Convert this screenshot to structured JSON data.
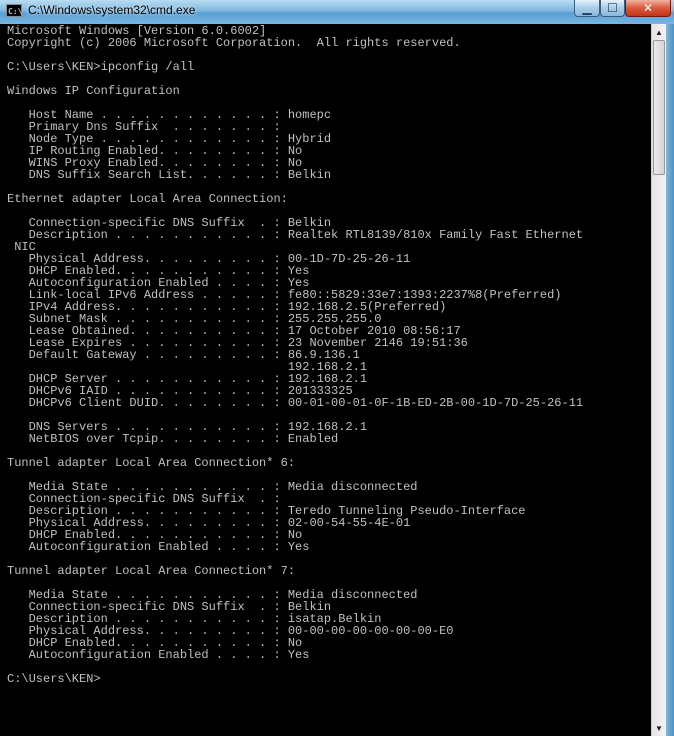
{
  "window": {
    "title": "C:\\Windows\\system32\\cmd.exe",
    "icon": "cmd-icon",
    "icon_text": "C:\\"
  },
  "controls": {
    "minimize": "▁",
    "maximize": "☐",
    "close": "✕"
  },
  "scrollbar": {
    "up": "▲",
    "down": "▼"
  },
  "console": {
    "lines": [
      "Microsoft Windows [Version 6.0.6002]",
      "Copyright (c) 2006 Microsoft Corporation.  All rights reserved.",
      "",
      "C:\\Users\\KEN>ipconfig /all",
      "",
      "Windows IP Configuration",
      "",
      "   Host Name . . . . . . . . . . . . : homepc",
      "   Primary Dns Suffix  . . . . . . . :",
      "   Node Type . . . . . . . . . . . . : Hybrid",
      "   IP Routing Enabled. . . . . . . . : No",
      "   WINS Proxy Enabled. . . . . . . . : No",
      "   DNS Suffix Search List. . . . . . : Belkin",
      "",
      "Ethernet adapter Local Area Connection:",
      "",
      "   Connection-specific DNS Suffix  . : Belkin",
      "   Description . . . . . . . . . . . : Realtek RTL8139/810x Family Fast Ethernet",
      " NIC",
      "   Physical Address. . . . . . . . . : 00-1D-7D-25-26-11",
      "   DHCP Enabled. . . . . . . . . . . : Yes",
      "   Autoconfiguration Enabled . . . . : Yes",
      "   Link-local IPv6 Address . . . . . : fe80::5829:33e7:1393:2237%8(Preferred)",
      "   IPv4 Address. . . . . . . . . . . : 192.168.2.5(Preferred)",
      "   Subnet Mask . . . . . . . . . . . : 255.255.255.0",
      "   Lease Obtained. . . . . . . . . . : 17 October 2010 08:56:17",
      "   Lease Expires . . . . . . . . . . : 23 November 2146 19:51:36",
      "   Default Gateway . . . . . . . . . : 86.9.136.1",
      "                                       192.168.2.1",
      "   DHCP Server . . . . . . . . . . . : 192.168.2.1",
      "   DHCPv6 IAID . . . . . . . . . . . : 201333325",
      "   DHCPv6 Client DUID. . . . . . . . : 00-01-00-01-0F-1B-ED-2B-00-1D-7D-25-26-11",
      "",
      "   DNS Servers . . . . . . . . . . . : 192.168.2.1",
      "   NetBIOS over Tcpip. . . . . . . . : Enabled",
      "",
      "Tunnel adapter Local Area Connection* 6:",
      "",
      "   Media State . . . . . . . . . . . : Media disconnected",
      "   Connection-specific DNS Suffix  . :",
      "   Description . . . . . . . . . . . : Teredo Tunneling Pseudo-Interface",
      "   Physical Address. . . . . . . . . : 02-00-54-55-4E-01",
      "   DHCP Enabled. . . . . . . . . . . : No",
      "   Autoconfiguration Enabled . . . . : Yes",
      "",
      "Tunnel adapter Local Area Connection* 7:",
      "",
      "   Media State . . . . . . . . . . . : Media disconnected",
      "   Connection-specific DNS Suffix  . : Belkin",
      "   Description . . . . . . . . . . . : isatap.Belkin",
      "   Physical Address. . . . . . . . . : 00-00-00-00-00-00-00-E0",
      "   DHCP Enabled. . . . . . . . . . . : No",
      "   Autoconfiguration Enabled . . . . : Yes",
      "",
      "C:\\Users\\KEN>"
    ]
  }
}
